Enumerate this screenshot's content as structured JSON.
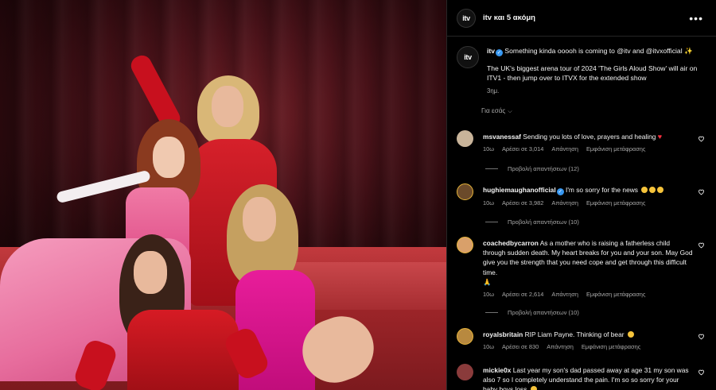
{
  "header": {
    "avatar_text": "itv",
    "title": "itv και 5 ακόμη",
    "more": "•••"
  },
  "caption": {
    "avatar_text": "itv",
    "user": "itv",
    "line1": "Something kinda ooooh is coming to @itv and @itvxofficial ✨",
    "line2": "The UK's biggest arena tour of 2024 'The Girls Aloud Show' will air on ITV1 - then jump over to ITVX for the extended show",
    "time": "3ημ."
  },
  "for_you": {
    "label": "Για εσάς",
    "chevron": "⌵"
  },
  "comments": [
    {
      "user": "msvanessaf",
      "text": "Sending you lots of love, prayers and healing",
      "time": "10ω",
      "likes": "Αρέσει σε 3,014",
      "reply": "Απάντηση",
      "translate": "Εμφάνιση μετάφρασης",
      "replies": "Προβολή απαντήσεων (12)",
      "avatar_color": "#c9b49a"
    },
    {
      "user": "hughiemaughanofficial",
      "text": "I'm so sorry for the news",
      "time": "10ω",
      "likes": "Αρέσει σε 3,982",
      "reply": "Απάντηση",
      "translate": "Εμφάνιση μετάφρασης",
      "replies": "Προβολή απαντήσεων (10)",
      "avatar_color": "#6b4a2a"
    },
    {
      "user": "coachedbycarron",
      "text": "As a mother who is raising a fatherless child through sudden death. My heart breaks for you and your son. May God give you the strength that you need cope and get through this difficult time.",
      "extra": "🙏",
      "time": "10ω",
      "likes": "Αρέσει σε 2,614",
      "reply": "Απάντηση",
      "translate": "Εμφάνιση μετάφρασης",
      "replies": "Προβολή απαντήσεων (10)",
      "avatar_color": "#d9a06a"
    },
    {
      "user": "royalsbritain",
      "text": "RIP Liam Payne. Thinking of bear",
      "time": "10ω",
      "likes": "Αρέσει σε 830",
      "reply": "Απάντηση",
      "translate": "Εμφάνιση μετάφρασης",
      "avatar_color": "#b8893f"
    },
    {
      "user": "mickie0x",
      "text": "Last year my son's dad passed away at age 31 my son was also 7 so I completely understand the pain. I'm so so sorry for your baby boys loss",
      "avatar_color": "#8a3b3b"
    }
  ],
  "colors": {
    "background": "#000000",
    "secondary_text": "#a8a8a8",
    "verified": "#3797f0",
    "like_red": "#ff3040"
  }
}
